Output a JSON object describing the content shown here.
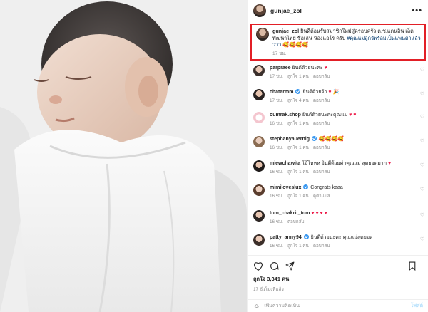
{
  "post": {
    "username": "gunjae_zol",
    "more_icon": "•••",
    "image_alt_icon": "newborn-photo"
  },
  "caption": {
    "username": "gunjae_zol",
    "text": "ยินดีต้อนรับสมาชิกใหม่สู่ครอบครัว ด.ช.แดนอิน เล็ตพัฒนาไทย ชื่อเล่น น้องแอโร ครับ",
    "hashtag": "#คุณแม่ลูกวัพร้อมเป็นแพนด้าแล้วววว",
    "emojis": "🥰🥰🥰🥰",
    "time": "17 ชม."
  },
  "comments": [
    {
      "username": "parpraee",
      "text": "ยินดีด้วยนะคะ",
      "emoji": "♥",
      "time": "17 ชม.",
      "likes": "ถูกใจ 1 คน",
      "reply": "ตอบกลับ",
      "verified": false
    },
    {
      "username": "chatarmm",
      "text": "ยินดีด้วยจ้า",
      "emoji": "♥ 🎉",
      "time": "17 ชม.",
      "likes": "ถูกใจ 4 คน",
      "reply": "ตอบกลับ",
      "verified": true
    },
    {
      "username": "oumrak.shop",
      "text": "ยินดีด้วยนะคะคุณแม่",
      "emoji": "♥ ♥",
      "time": "16 ชม.",
      "likes": "ถูกใจ 1 คน",
      "reply": "ตอบกลับ",
      "verified": false
    },
    {
      "username": "stephanyauernig",
      "text": "",
      "emoji": "🥰🥰🥰🥰",
      "time": "16 ชม.",
      "likes": "ถูกใจ 1 คน",
      "reply": "ตอบกลับ",
      "verified": true
    },
    {
      "username": "miewchawita",
      "text": "โอ้โหหห ยินดีด้วยค่าคุณแม่ สุดยอดมาก",
      "emoji": "♥",
      "time": "16 ชม.",
      "likes": "ถูกใจ 1 คน",
      "reply": "ตอบกลับ",
      "verified": false
    },
    {
      "username": "mimiloveslux",
      "text": "Congrats kaaa",
      "emoji": "",
      "time": "16 ชม.",
      "likes": "ถูกใจ 1 คน",
      "reply": "ดูคำแปล",
      "verified": true
    },
    {
      "username": "tom_chakrit_tom",
      "text": "",
      "emoji": "♥ ♥ ♥ ♥",
      "time": "16 ชม.",
      "likes": "",
      "reply": "ตอบกลับ",
      "verified": false
    },
    {
      "username": "patty_anny94",
      "text": "ยินดีด้วยนะคะ คุณแม่สุดยอด",
      "emoji": "",
      "time": "16 ชม.",
      "likes": "ถูกใจ 1 คน",
      "reply": "ตอบกลับ",
      "verified": true
    }
  ],
  "actions": {
    "likes": "ถูกใจ 3,341 คน",
    "posted": "17 ชั่วโมงที่แล้ว"
  },
  "add_comment": {
    "placeholder": "เพิ่มความคิดเห็น",
    "post_label": "โพสต์"
  },
  "colors": {
    "highlight_border": "#e21f26",
    "heart": "#ed1c4a",
    "link": "#00376b",
    "verified": "#3897f0"
  }
}
